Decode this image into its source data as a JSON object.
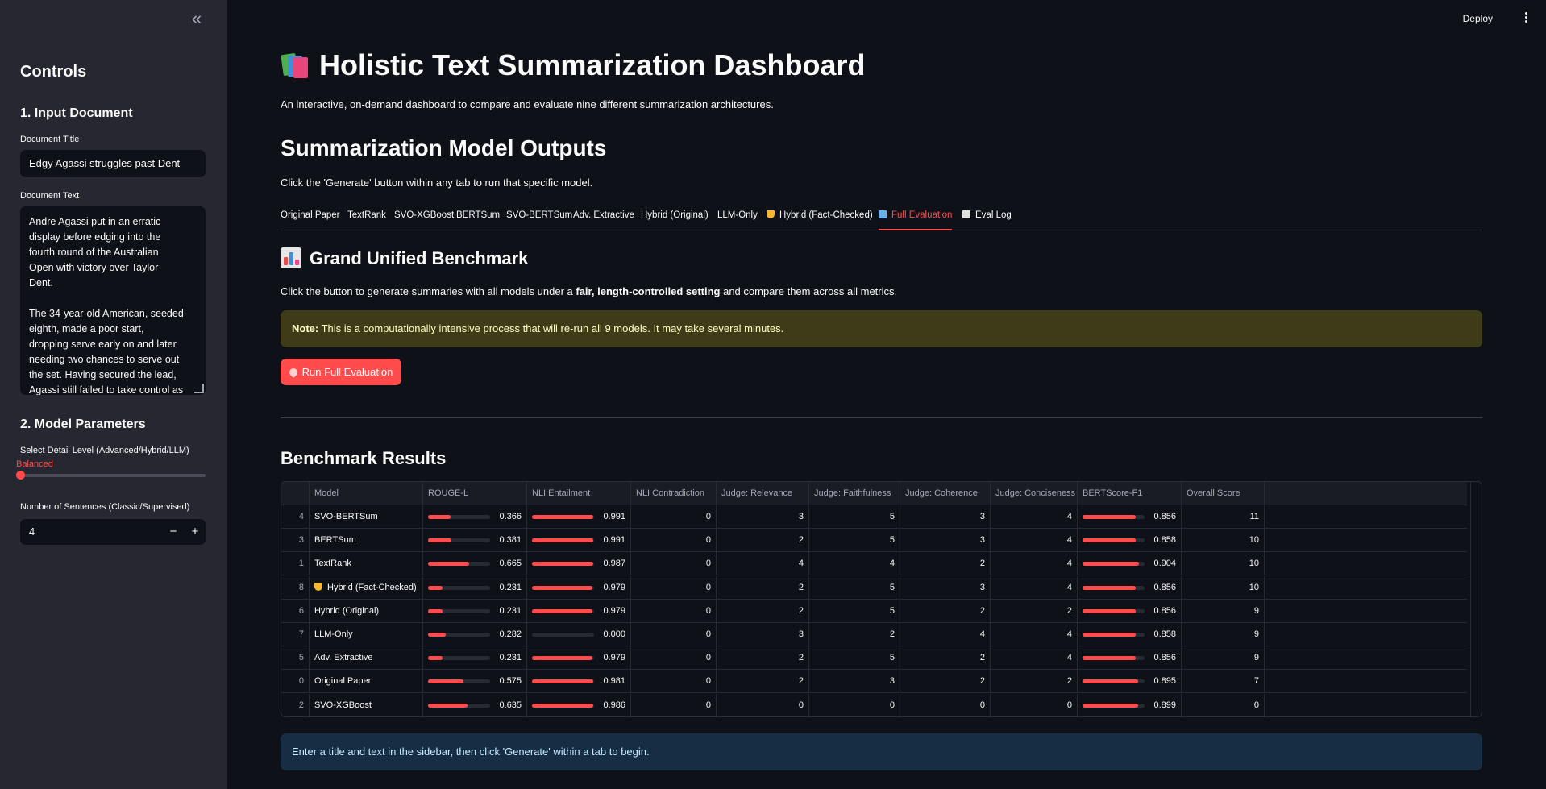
{
  "sidebar": {
    "title": "Controls",
    "section1": "1. Input Document",
    "doc_title_label": "Document Title",
    "doc_title_value": "Edgy Agassi struggles past Dent",
    "doc_text_label": "Document Text",
    "doc_text_p1": "Andre Agassi put in an erratic display before edging into the fourth round of the Australian Open with victory over Taylor Dent.",
    "doc_text_p2": "The 34-year-old American, seeded eighth, made a poor start, dropping serve early on and later needing two chances to serve out the set. Having secured the lead, Agassi still failed to take control as",
    "section2": "2. Model Parameters",
    "detail_label": "Select Detail Level (Advanced/Hybrid/LLM)",
    "detail_value": "Balanced",
    "sentences_label": "Number of Sentences (Classic/Supervised)",
    "sentences_value": "4",
    "minus": "−",
    "plus": "+"
  },
  "topbar": {
    "deploy": "Deploy"
  },
  "main": {
    "title": "Holistic Text Summarization Dashboard",
    "subtitle": "An interactive, on-demand dashboard to compare and evaluate nine different summarization architectures.",
    "outputs_heading": "Summarization Model Outputs",
    "outputs_desc": "Click the 'Generate' button within any tab to run that specific model.",
    "tabs": [
      "Original Paper",
      "TextRank",
      "SVO-XGBoost",
      "BERTSum",
      "SVO-BERTSum",
      "Adv. Extractive",
      "Hybrid (Original)",
      "LLM-Only",
      "Hybrid (Fact-Checked)",
      "Full Evaluation",
      "Eval Log"
    ],
    "benchmark_heading": "Grand Unified Benchmark",
    "benchmark_desc_pre": "Click the button to generate summaries with all models under a ",
    "benchmark_desc_bold": "fair, length-controlled setting",
    "benchmark_desc_post": " and compare them across all metrics.",
    "note_label": "Note:",
    "note_text": " This is a computationally intensive process that will re-run all 9 models. It may take several minutes.",
    "run_button": "Run Full Evaluation",
    "results_heading": "Benchmark Results",
    "info": "Enter a title and text in the sidebar, then click 'Generate' within a tab to begin."
  },
  "table": {
    "columns": [
      "",
      "Model",
      "ROUGE-L",
      "NLI Entailment",
      "NLI Contradiction",
      "Judge: Relevance",
      "Judge: Faithfulness",
      "Judge: Coherence",
      "Judge: Conciseness",
      "BERTScore-F1",
      "Overall Score"
    ],
    "rows": [
      {
        "idx": "4",
        "model": "SVO-BERTSum",
        "rouge": 0.366,
        "rouge_t": "0.366",
        "nli_e": 0.991,
        "nli_e_t": "0.991",
        "nli_c": "0",
        "rel": "3",
        "faith": "5",
        "coh": "3",
        "conc": "4",
        "bert": 0.856,
        "bert_t": "0.856",
        "overall": "11",
        "trophy": false
      },
      {
        "idx": "3",
        "model": "BERTSum",
        "rouge": 0.381,
        "rouge_t": "0.381",
        "nli_e": 0.991,
        "nli_e_t": "0.991",
        "nli_c": "0",
        "rel": "2",
        "faith": "5",
        "coh": "3",
        "conc": "4",
        "bert": 0.858,
        "bert_t": "0.858",
        "overall": "10",
        "trophy": false
      },
      {
        "idx": "1",
        "model": "TextRank",
        "rouge": 0.665,
        "rouge_t": "0.665",
        "nli_e": 0.987,
        "nli_e_t": "0.987",
        "nli_c": "0",
        "rel": "4",
        "faith": "4",
        "coh": "2",
        "conc": "4",
        "bert": 0.904,
        "bert_t": "0.904",
        "overall": "10",
        "trophy": false
      },
      {
        "idx": "8",
        "model": "Hybrid (Fact-Checked)",
        "rouge": 0.231,
        "rouge_t": "0.231",
        "nli_e": 0.979,
        "nli_e_t": "0.979",
        "nli_c": "0",
        "rel": "2",
        "faith": "5",
        "coh": "3",
        "conc": "4",
        "bert": 0.856,
        "bert_t": "0.856",
        "overall": "10",
        "trophy": true
      },
      {
        "idx": "6",
        "model": "Hybrid (Original)",
        "rouge": 0.231,
        "rouge_t": "0.231",
        "nli_e": 0.979,
        "nli_e_t": "0.979",
        "nli_c": "0",
        "rel": "2",
        "faith": "5",
        "coh": "2",
        "conc": "2",
        "bert": 0.856,
        "bert_t": "0.856",
        "overall": "9",
        "trophy": false
      },
      {
        "idx": "7",
        "model": "LLM-Only",
        "rouge": 0.282,
        "rouge_t": "0.282",
        "nli_e": 0.0,
        "nli_e_t": "0.000",
        "nli_c": "0",
        "rel": "3",
        "faith": "2",
        "coh": "4",
        "conc": "4",
        "bert": 0.858,
        "bert_t": "0.858",
        "overall": "9",
        "trophy": false
      },
      {
        "idx": "5",
        "model": "Adv. Extractive",
        "rouge": 0.231,
        "rouge_t": "0.231",
        "nli_e": 0.979,
        "nli_e_t": "0.979",
        "nli_c": "0",
        "rel": "2",
        "faith": "5",
        "coh": "2",
        "conc": "4",
        "bert": 0.856,
        "bert_t": "0.856",
        "overall": "9",
        "trophy": false
      },
      {
        "idx": "0",
        "model": "Original Paper",
        "rouge": 0.575,
        "rouge_t": "0.575",
        "nli_e": 0.981,
        "nli_e_t": "0.981",
        "nli_c": "0",
        "rel": "2",
        "faith": "3",
        "coh": "2",
        "conc": "2",
        "bert": 0.895,
        "bert_t": "0.895",
        "overall": "7",
        "trophy": false
      },
      {
        "idx": "2",
        "model": "SVO-XGBoost",
        "rouge": 0.635,
        "rouge_t": "0.635",
        "nli_e": 0.986,
        "nli_e_t": "0.986",
        "nli_c": "0",
        "rel": "0",
        "faith": "0",
        "coh": "0",
        "conc": "0",
        "bert": 0.899,
        "bert_t": "0.899",
        "overall": "0",
        "trophy": false
      }
    ]
  },
  "colors": {
    "accent": "#ff4b4b",
    "sidebar_bg": "#262730",
    "page_bg": "#0e1117",
    "warning_bg": "#3e3c18",
    "info_bg": "#172d43"
  },
  "icons": [
    "collapse-sidebar-icon",
    "kebab-menu-icon",
    "books-icon",
    "bar-chart-icon",
    "trophy-icon",
    "page-icon",
    "rocket-icon"
  ]
}
